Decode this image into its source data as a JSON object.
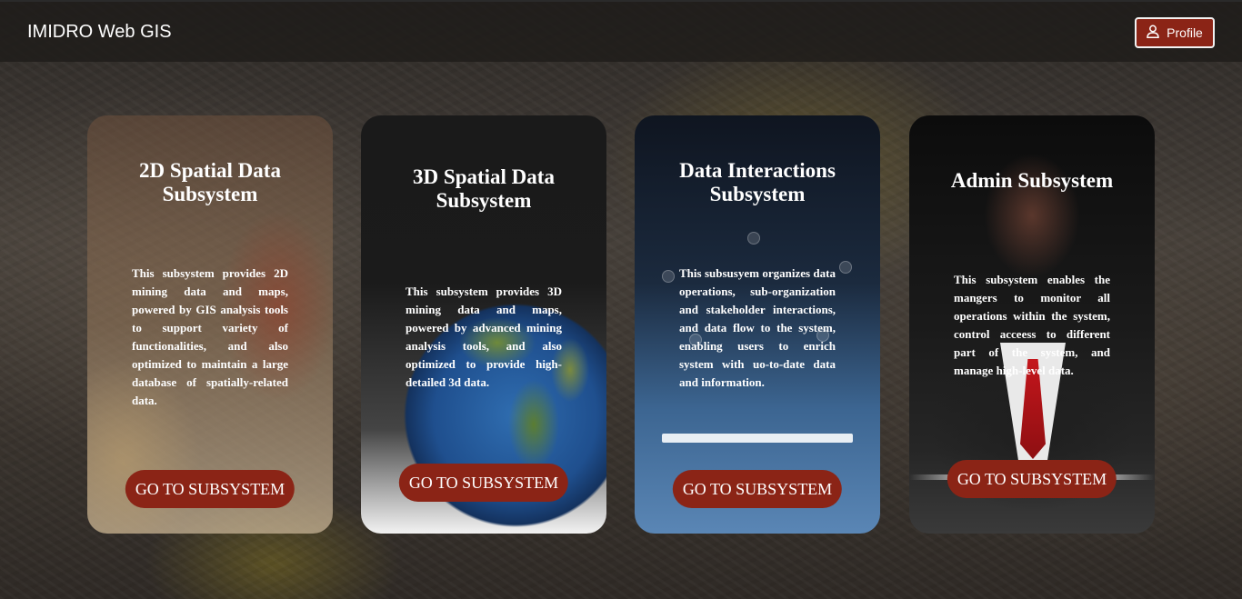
{
  "navbar": {
    "brand": "IMIDRO Web GIS",
    "profile_label": "Profile"
  },
  "colors": {
    "accent": "#8b2416",
    "navbar_bg": "#1e1c1a"
  },
  "cards": [
    {
      "title": "2D Spatial Data Subsystem",
      "description": "This subsystem provides 2D mining data and maps, powered by GIS analysis tools to support variety of functionalities, and also optimized to maintain a large database of spatially-related data.",
      "button": "GO TO SUBSYSTEM"
    },
    {
      "title": "3D Spatial Data Subsystem",
      "description": "This subsystem provides 3D mining data and maps, powered by advanced mining analysis tools, and also optimized to provide high-detailed 3d data.",
      "button": "GO TO SUBSYSTEM"
    },
    {
      "title": "Data Interactions Subsystem",
      "description": "This subsusyem organizes data operations, sub-organization and stakeholder interactions, and data flow to the system, enabling users to enrich system with uo-to-date data and information.",
      "button": "GO TO SUBSYSTEM"
    },
    {
      "title": "Admin Subsystem",
      "description": "This subsystem enables the mangers to monitor all operations within the system, control acceess to different part of the system, and manage high-level data.",
      "button": "GO TO SUBSYSTEM"
    }
  ]
}
